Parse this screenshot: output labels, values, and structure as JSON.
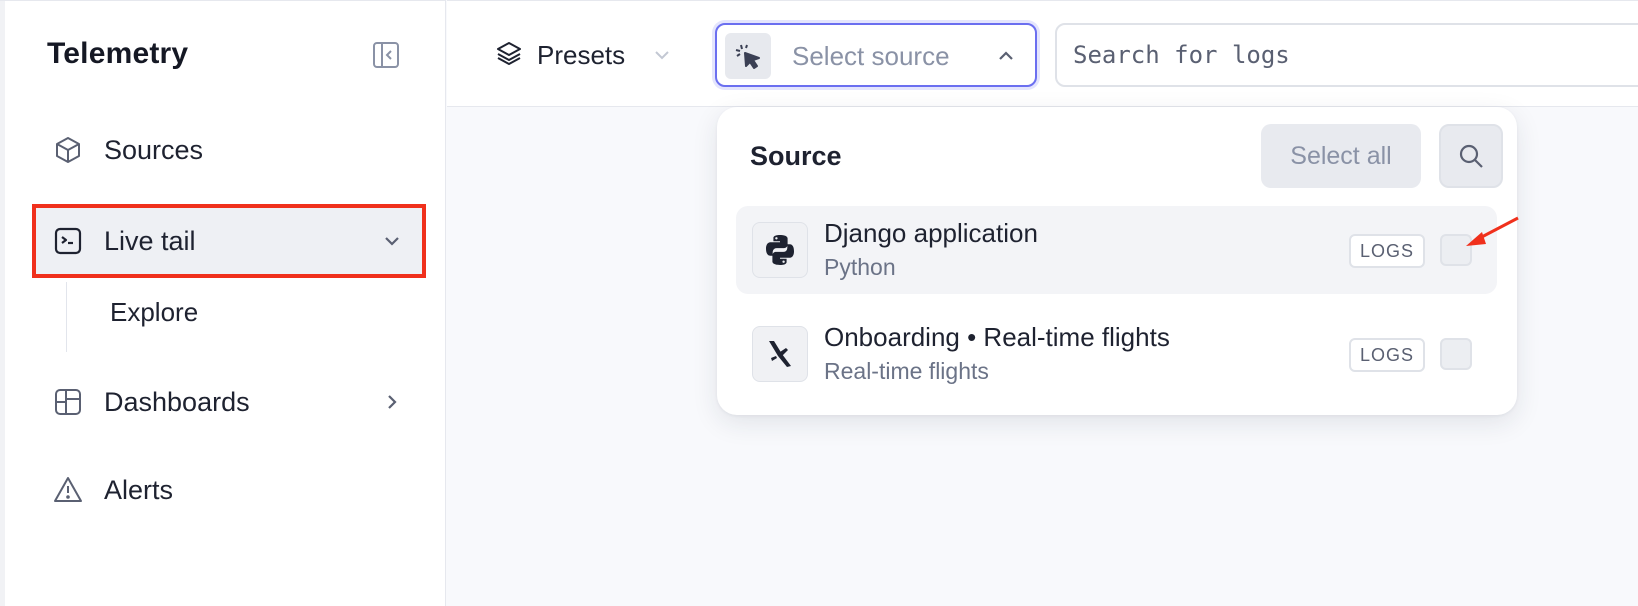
{
  "sidebar": {
    "brand": "Telemetry",
    "items": [
      {
        "label": "Sources"
      },
      {
        "label": "Live tail"
      },
      {
        "label": "Dashboards"
      },
      {
        "label": "Alerts"
      }
    ],
    "sub_items": [
      {
        "label": "Explore"
      }
    ]
  },
  "toolbar": {
    "presets_label": "Presets",
    "source_placeholder": "Select source",
    "search_placeholder": "Search for logs"
  },
  "dropdown": {
    "title": "Source",
    "select_all_label": "Select all",
    "sources": [
      {
        "name": "Django application",
        "subtitle": "Python",
        "tag": "LOGS",
        "icon": "python-icon"
      },
      {
        "name": "Onboarding • Real-time flights",
        "subtitle": "Real-time flights",
        "tag": "LOGS",
        "icon": "flight-icon"
      }
    ]
  },
  "colors": {
    "highlight_box": "#f0301c",
    "focus_ring": "#6b6ff0",
    "annotation_arrow": "#f0301c"
  }
}
